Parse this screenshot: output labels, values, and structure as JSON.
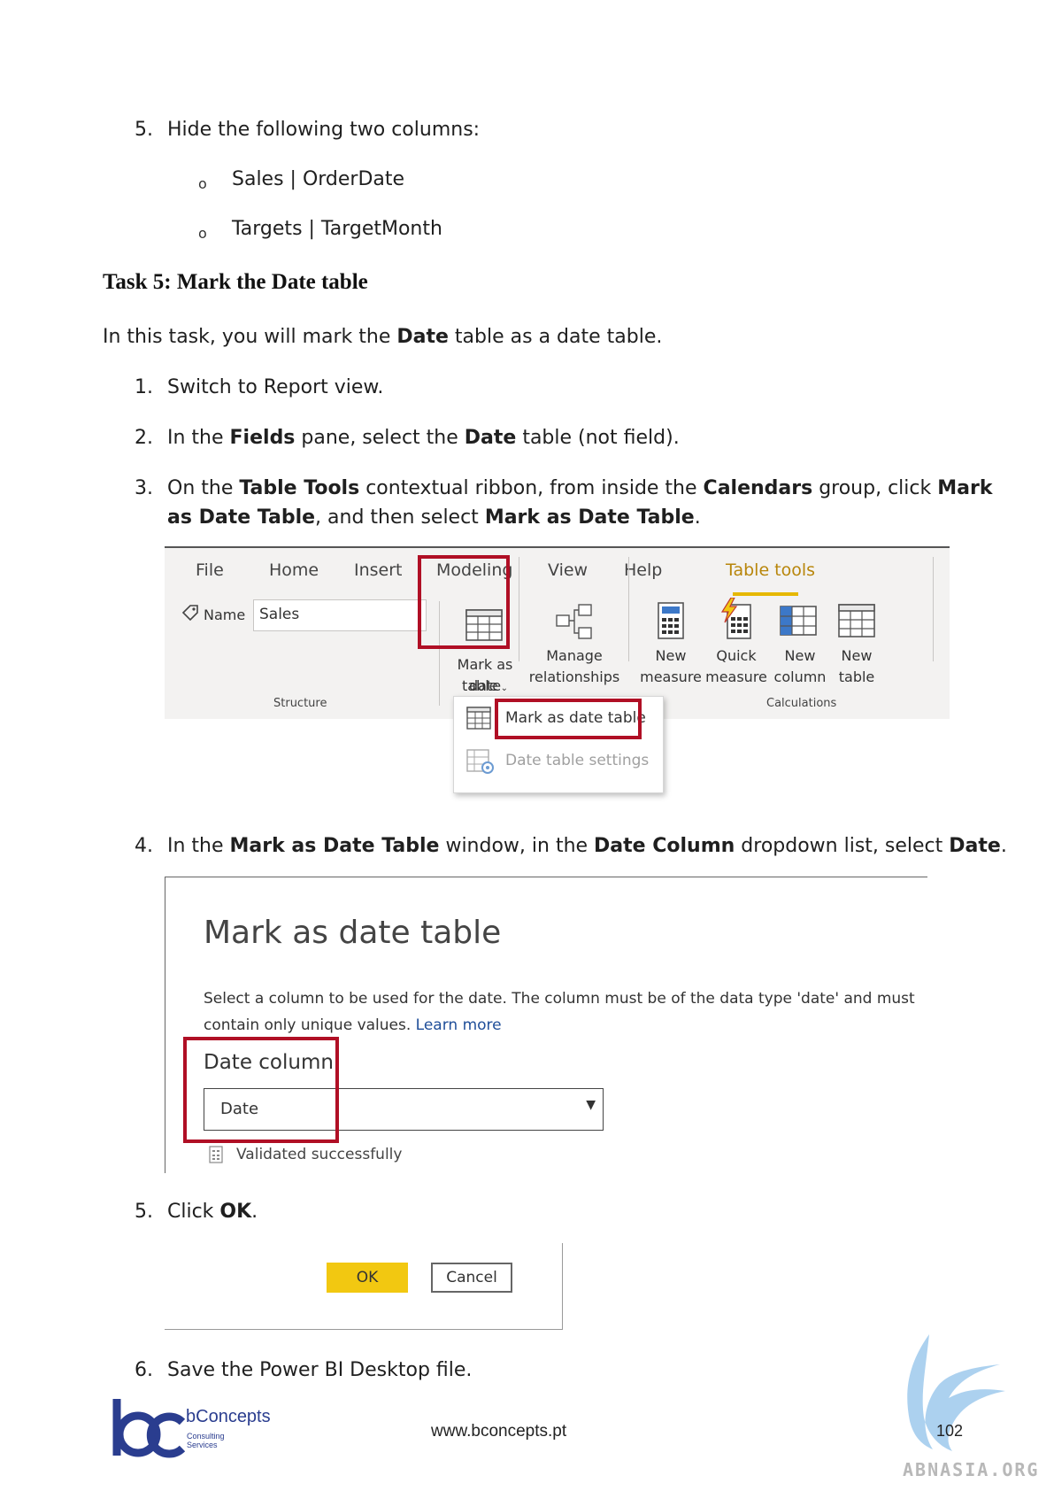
{
  "step5a": {
    "num": "5.",
    "text": "Hide the following two columns:",
    "bullets": [
      "Sales | OrderDate",
      "Targets | TargetMonth"
    ],
    "bullet_char": "o"
  },
  "task": {
    "heading": "Task 5: Mark the Date table",
    "intro_pre": "In this task, you will mark the ",
    "intro_bold": "Date",
    "intro_post": " table as a date table."
  },
  "steps": {
    "s1": {
      "num": "1.",
      "text": "Switch to Report view."
    },
    "s2": {
      "num": "2.",
      "t1": "In the ",
      "b1": "Fields",
      "t2": " pane, select the ",
      "b2": "Date",
      "t3": " table (not field)."
    },
    "s3": {
      "num": "3.",
      "t1": "On the ",
      "b1": "Table Tools",
      "t2": " contextual ribbon, from inside the ",
      "b2": "Calendars",
      "t3": " group, click ",
      "b3": "Mark",
      "l2b1": "as Date Table",
      "l2t1": ", and then select ",
      "l2b2": "Mark as Date Table",
      "l2t2": "."
    },
    "s4": {
      "num": "4.",
      "t1": "In the ",
      "b1": "Mark as Date Table",
      "t2": " window, in the ",
      "b2": "Date Column",
      "t3": " dropdown list, select ",
      "b3": "Date",
      "t4": "."
    },
    "s5": {
      "num": "5.",
      "t1": "Click ",
      "b1": "OK",
      "t2": "."
    },
    "s6": {
      "num": "6.",
      "text": "Save the Power BI Desktop file."
    }
  },
  "ribbon": {
    "tabs": [
      "File",
      "Home",
      "Insert",
      "Modeling",
      "View",
      "Help",
      "Table tools"
    ],
    "name_label": "Name",
    "name_value": "Sales",
    "mark_line1": "Mark as date",
    "mark_line2": "table",
    "manage_line1": "Manage",
    "manage_line2": "relationships",
    "new_measure_1": "New",
    "new_measure_2": "measure",
    "quick_measure_1": "Quick",
    "quick_measure_2": "measure",
    "new_column_1": "New",
    "new_column_2": "column",
    "new_table_1": "New",
    "new_table_2": "table",
    "group_structure": "Structure",
    "group_calculations": "Calculations",
    "menu_item_1": "Mark as date table",
    "menu_item_2": "Date table settings",
    "accent": "#e6b800",
    "highlight": "#b00f25"
  },
  "dialog": {
    "title": "Mark as date table",
    "desc": "Select a column to be used for the date. The column must be of the data type 'date' and must contain only unique values.",
    "link": "Learn more",
    "label": "Date column",
    "selected": "Date",
    "status": "Validated successfully"
  },
  "buttons": {
    "ok": "OK",
    "cancel": "Cancel",
    "ok_color": "#f2c811"
  },
  "footer": {
    "company": "bConcepts",
    "company_sub_1": "Consulting",
    "company_sub_2": "Services",
    "url": "www.bconcepts.pt",
    "page": "102",
    "watermark": "ABNASIA.ORG"
  }
}
